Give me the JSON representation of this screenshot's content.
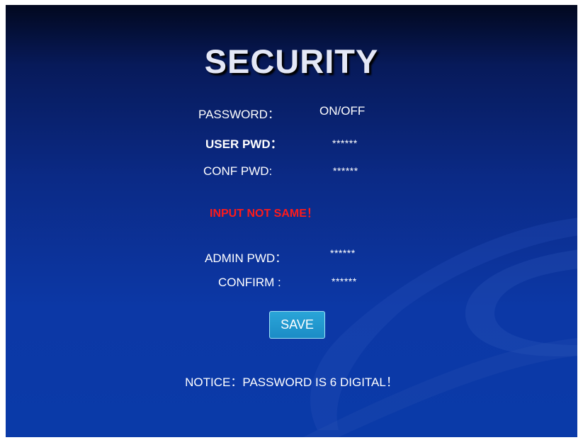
{
  "screen": {
    "title": "SECURITY",
    "colors": {
      "background": "#0b2f92",
      "error": "#ff1a1a",
      "button": "#1e95cb"
    }
  },
  "password_toggle": {
    "label": "PASSWORD：",
    "value": "ON/OFF"
  },
  "user_pwd": {
    "label": "USER PWD：",
    "value": "******"
  },
  "conf_pwd": {
    "label": "CONF PWD:",
    "value": "******"
  },
  "error_message": "INPUT NOT SAME！",
  "admin_pwd": {
    "label": "ADMIN PWD：",
    "value": "******"
  },
  "confirm": {
    "label": "CONFIRM :",
    "value": "******"
  },
  "save_button": "SAVE",
  "notice": "NOTICE：PASSWORD IS 6 DIGITAL！"
}
